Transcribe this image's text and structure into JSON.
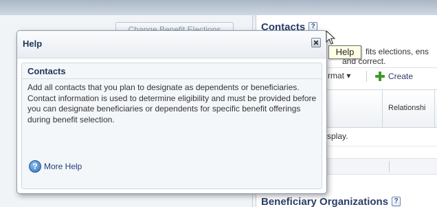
{
  "background": {
    "change_benefit_elections": "Change Benefit Elections",
    "contacts_title": "Contacts",
    "help_icon_label": "?",
    "description_line1": "fits elections, ens",
    "description_line2": "and correct.",
    "format_menu": "rmat ▾",
    "create_button": "Create",
    "column_relationship": "Relationshi",
    "no_data_text": "splay.",
    "beneficiary_title": "Beneficiary Organizations"
  },
  "tooltip": {
    "text": "Help"
  },
  "help_dialog": {
    "title": "Help",
    "subtitle": "Contacts",
    "body": "Add all contacts that you plan to designate as dependents or beneficiaries. Contact information is used to determine eligibility and must be provided before you can designate beneficiaries or dependents for specific benefit offerings during benefit selection.",
    "more_help_label": "More Help",
    "more_help_icon_glyph": "?"
  },
  "icons": {
    "close": "close-icon",
    "help": "help-icon",
    "create": "plus-icon",
    "cursor": "mouse-pointer-icon"
  },
  "colors": {
    "title_text": "#2b3e66",
    "create_plus": "#3d9a2a",
    "tooltip_bg": "#ffffe6",
    "more_help_icon": "#2f6fc0"
  }
}
